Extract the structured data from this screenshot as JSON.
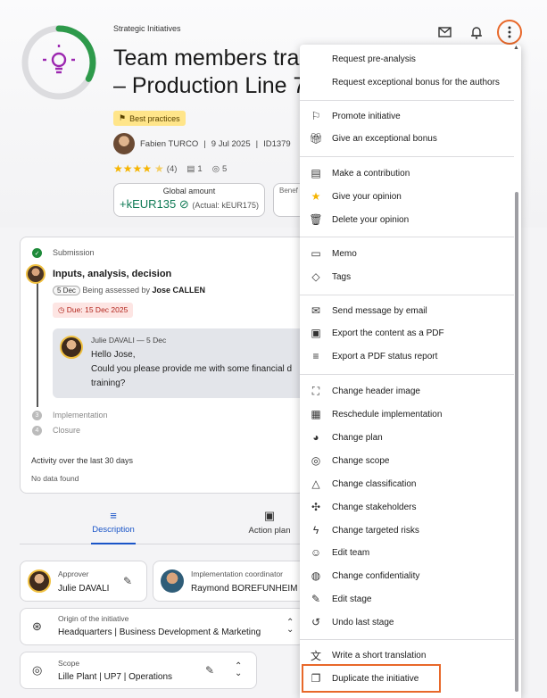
{
  "header": {
    "category": "Strategic Initiatives",
    "title_line1": "Team members trair",
    "title_line2": "– Production Line 7",
    "badge": "Best practices",
    "author": "Fabien TURCO",
    "date": "9 Jul 2025",
    "id": "ID1379",
    "rating_count": "(4)",
    "comments": "1",
    "views": "5",
    "global_amount_label": "Global amount",
    "global_amount_value": "+kEUR135",
    "global_amount_actual": "(Actual: kEUR175)",
    "benefit_label": "Benef",
    "progress_fraction": 0.33,
    "accent_color": "#9c27b0",
    "progress_color": "#2e9a4b"
  },
  "timeline": {
    "step1": "Submission",
    "step_active": "Inputs, analysis, decision",
    "days_pill": "5 Dec",
    "assessed_prefix": "Being assessed by",
    "assessed_by": "Jose CALLEN",
    "due": "Due: 15 Dec 2025",
    "comment_author": "Julie DAVALI — 5 Dec",
    "comment_line1": "Hello Jose,",
    "comment_line2": "Could you please provide me with some financial d",
    "comment_line3": "training?",
    "step3_num": "3",
    "step3": "Implementation",
    "step4_num": "4",
    "step4": "Closure",
    "activity": "Activity over the last 30 days",
    "nodata": "No data found"
  },
  "tabs": {
    "description": "Description",
    "action_plan": "Action plan"
  },
  "cards": {
    "approver_label": "Approver",
    "approver": "Julie DAVALI",
    "coordinator_label": "Implementation coordinator",
    "coordinator": "Raymond BOREFUNHEIM",
    "origin_label": "Origin of the initiative",
    "origin": "Headquarters | Business Development & Marketing",
    "scope_label": "Scope",
    "scope": "Lille Plant | UP7 | Operations"
  },
  "menu": {
    "request_preanalysis": "Request pre-analysis",
    "request_bonus": "Request exceptional bonus for the authors",
    "promote": "Promote initiative",
    "give_bonus": "Give an exceptional bonus",
    "contribution": "Make a contribution",
    "give_opinion": "Give your opinion",
    "delete_opinion": "Delete your opinion",
    "memo": "Memo",
    "tags": "Tags",
    "send_email": "Send message by email",
    "export_pdf": "Export the content as a PDF",
    "export_status": "Export a PDF status report",
    "change_header": "Change header image",
    "reschedule": "Reschedule implementation",
    "change_plan": "Change plan",
    "change_scope": "Change scope",
    "change_classification": "Change classification",
    "change_stakeholders": "Change stakeholders",
    "change_risks": "Change targeted risks",
    "edit_team": "Edit team",
    "change_confidentiality": "Change confidentiality",
    "edit_stage": "Edit stage",
    "undo_stage": "Undo last stage",
    "write_translation": "Write a short translation",
    "duplicate": "Duplicate the initiative"
  }
}
